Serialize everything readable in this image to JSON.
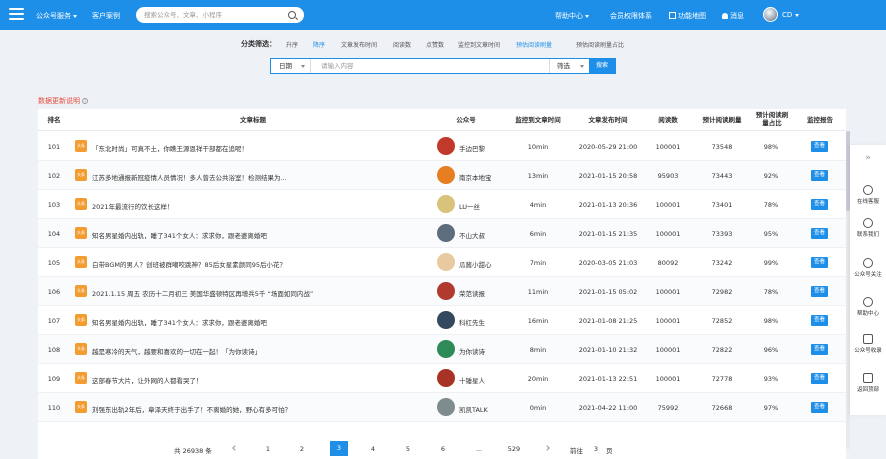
{
  "header": {
    "nav_service": "公众号服务",
    "nav_customer": "客户案例",
    "search_placeholder": "搜索公众号、文章、小程序",
    "nav_help": "帮助中心",
    "nav_member": "会员权限体系",
    "nav_map": "功能地图",
    "nav_notice": "消息",
    "user": "CD"
  },
  "filter": {
    "label": "分类筛选：",
    "options": [
      "升序",
      "降序",
      "文章发布时间",
      "阅读数",
      "点赞数",
      "监控到文章时间",
      "预估阅读刷量",
      "预估阅读刷量占比"
    ],
    "date_label": "日期",
    "keyword_placeholder": "请输入内容",
    "select_label": "筛选",
    "search_label": "搜索"
  },
  "note": "数据更新说明",
  "table": {
    "columns": [
      "排名",
      "文章标题",
      "公众号",
      "监控到文章时间",
      "文章发布时间",
      "阅读数",
      "预计阅读刷量",
      "预计阅读刷量占比",
      "监控报告"
    ],
    "report_label": "查看",
    "rows": [
      {
        "rank": "101",
        "badge": "头条",
        "title": "「东北时尚」可真不土，你瞧王源恩祥干部都在追呢！",
        "account": "手边巴黎",
        "monitor": "10min",
        "pub": "2020-05-29 21:00",
        "read": "100001",
        "pred": "73548",
        "ratio": "98%"
      },
      {
        "rank": "102",
        "badge": "头条",
        "title": "江苏多地通报新冠疫情人员情况！多人曾去公共浴室！检测结果为...",
        "account": "南京本地宝",
        "monitor": "13min",
        "pub": "2021-01-15 20:58",
        "read": "95903",
        "pred": "73443",
        "ratio": "92%"
      },
      {
        "rank": "103",
        "badge": "头条",
        "title": "2021年最流行的饮长这样！",
        "account": "LU一丝",
        "monitor": "4min",
        "pub": "2021-01-13 20:36",
        "read": "100001",
        "pred": "73401",
        "ratio": "78%"
      },
      {
        "rank": "104",
        "badge": "头条",
        "title": "知名男星婚内出轨，睡了341个女人：求求你，跟老婆离婚吧",
        "account": "不山大叔",
        "monitor": "6min",
        "pub": "2021-01-15 21:35",
        "read": "100001",
        "pred": "73393",
        "ratio": "95%"
      },
      {
        "rank": "105",
        "badge": "头条",
        "title": "白带BGM的男人？创班被群嘲咬跳神？85后女星素颜同95后小花？",
        "account": "瓜酱小甜心",
        "monitor": "7min",
        "pub": "2020-03-05 21:03",
        "read": "80092",
        "pred": "73242",
        "ratio": "99%"
      },
      {
        "rank": "106",
        "badge": "头条",
        "title": "2021.1.15 周五 农历十二月初三 美国华盛顿特区再增兵5千 “场面如同内战”",
        "account": "荣范读报",
        "monitor": "11min",
        "pub": "2021-01-15 05:02",
        "read": "100001",
        "pred": "72982",
        "ratio": "78%"
      },
      {
        "rank": "107",
        "badge": "头条",
        "title": "知名男星婚内出轨，睡了341个女人：求求你，跟老婆离婚吧",
        "account": "科红先生",
        "monitor": "16min",
        "pub": "2021-01-08 21:25",
        "read": "100001",
        "pred": "72852",
        "ratio": "98%"
      },
      {
        "rank": "108",
        "badge": "头条",
        "title": "越是寒冷的天气，越要和喜欢的一切在一起！「为你读诗」",
        "account": "为你读诗",
        "monitor": "8min",
        "pub": "2021-01-10 21:32",
        "read": "100001",
        "pred": "72822",
        "ratio": "96%"
      },
      {
        "rank": "109",
        "badge": "头条",
        "title": "这部春节大片，让外网的人都看哭了！",
        "account": "十锤星人",
        "monitor": "20min",
        "pub": "2021-01-13 22:51",
        "read": "100001",
        "pred": "72778",
        "ratio": "93%"
      },
      {
        "rank": "110",
        "badge": "头条",
        "title": "刘强东出轨2年后，章泽天终于出手了！不离婚的她，野心有多可怕？",
        "account": "凯凯TALK",
        "monitor": "0min",
        "pub": "2021-04-22 11:00",
        "read": "75992",
        "pred": "72668",
        "ratio": "97%"
      }
    ]
  },
  "pagination": {
    "total": "共 26938 条",
    "pages": [
      "1",
      "2",
      "3",
      "4",
      "5",
      "6",
      "...",
      "529"
    ],
    "active": "3",
    "goto_label": "前往",
    "goto_value": "3",
    "page_unit": "页"
  },
  "sidebar": {
    "items": [
      "在线客服",
      "联系我们",
      "公众号关注",
      "帮助中心",
      "公众号收录",
      "返回顶部"
    ]
  }
}
